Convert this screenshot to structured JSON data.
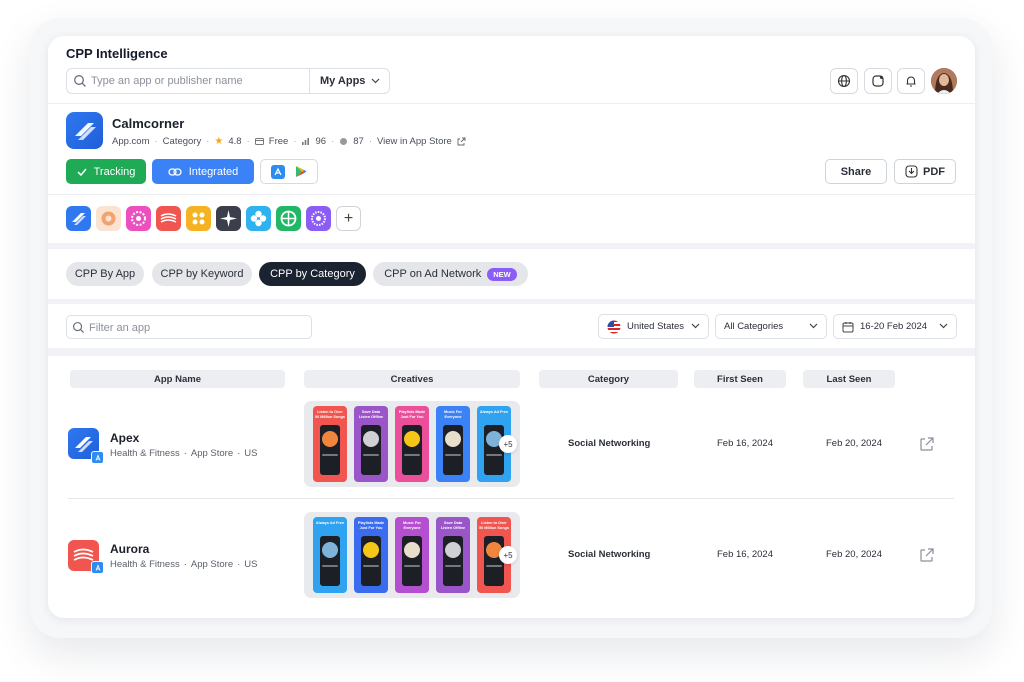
{
  "header": {
    "title": "CPP Intelligence",
    "search_placeholder": "Type an app or publisher name",
    "my_apps_label": "My Apps"
  },
  "app": {
    "name": "Calmcorner",
    "publisher": "App.com",
    "category": "Category",
    "rating": "4.8",
    "price": "Free",
    "rank": "96",
    "score": "87",
    "store_link": "View in App Store",
    "tracking_label": "Tracking",
    "integrated_label": "Integrated",
    "share_label": "Share",
    "pdf_label": "PDF"
  },
  "tabs": [
    {
      "label": "CPP By App"
    },
    {
      "label": "CPP by Keyword"
    },
    {
      "label": "CPP by Category",
      "active": true
    },
    {
      "label": "CPP on Ad Network",
      "badge": "NEW"
    }
  ],
  "filters": {
    "filter_placeholder": "Filter an app",
    "country": "United States",
    "category": "All Categories",
    "date_range": "16-20 Feb 2024"
  },
  "table": {
    "columns": [
      "App Name",
      "Creatives",
      "Category",
      "First Seen",
      "Last Seen"
    ],
    "rows": [
      {
        "name": "Apex",
        "genre": "Health & Fitness",
        "store": "App Store",
        "country": "US",
        "category": "Social Networking",
        "first_seen": "Feb 16, 2024",
        "last_seen": "Feb 20, 2024",
        "more": "+5",
        "creatives": [
          "Listen to Over 50 Million Songs",
          "Save Data Listen Offline",
          "Playlists Made Just For You",
          "Music For Everyone",
          "Always Ad Free"
        ]
      },
      {
        "name": "Aurora",
        "genre": "Health & Fitness",
        "store": "App Store",
        "country": "US",
        "category": "Social Networking",
        "first_seen": "Feb 16, 2024",
        "last_seen": "Feb 20, 2024",
        "more": "+5",
        "creatives": [
          "Always Ad Free",
          "Playlists Made Just For You",
          "Music For Everyone",
          "Save Data Listen Offline",
          "Listen to Over 50 Million Songs"
        ]
      }
    ]
  },
  "colors": {
    "tracking": "#1faa55",
    "integrated": "#3a82f6",
    "active_tab": "#1b2230",
    "new_badge": "#8b5cf6"
  }
}
